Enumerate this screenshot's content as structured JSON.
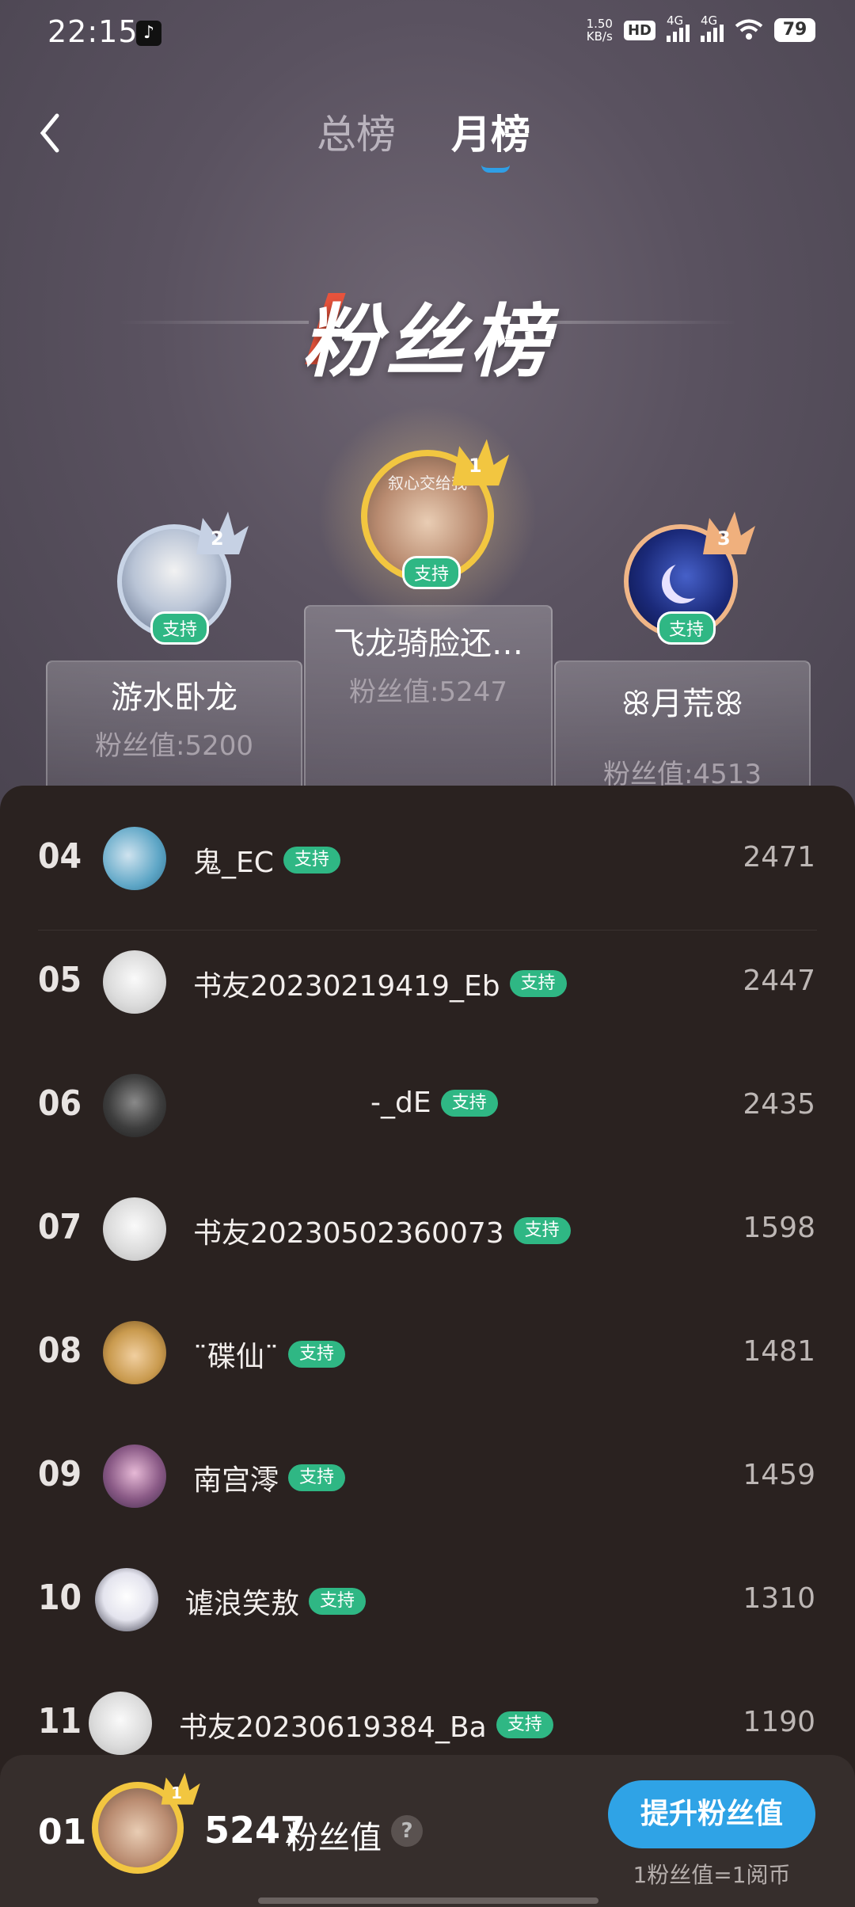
{
  "status_bar": {
    "time": "22:15",
    "net_speed_value": "1.50",
    "net_speed_unit": "KB/s",
    "hd_label": "HD",
    "sim1_label": "4G",
    "sim2_label": "4G",
    "battery": "79"
  },
  "nav": {
    "tabs": [
      {
        "label": "总榜",
        "active": false
      },
      {
        "label": "月榜",
        "active": true
      }
    ]
  },
  "title": "粉丝榜",
  "podium": {
    "first": {
      "name": "飞龙骑脸还…",
      "fans": "粉丝值:5247",
      "rank_badge": "1",
      "support_label": "支持",
      "avatar_text": "叙心交给我"
    },
    "second": {
      "name": "游水卧龙",
      "fans": "粉丝值:5200",
      "rank_badge": "2",
      "support_label": "支持"
    },
    "third": {
      "name": "月荒",
      "fans": "粉丝值:4513",
      "rank_badge": "3",
      "support_label": "支持"
    }
  },
  "list": [
    {
      "rank": "04",
      "name": "鬼_EC",
      "tag": "支持",
      "score": "2471"
    },
    {
      "rank": "05",
      "name": "书友20230219419_Eb",
      "tag": "支持",
      "score": "2447"
    },
    {
      "rank": "06",
      "name": "-_dE",
      "tag": "支持",
      "score": "2435"
    },
    {
      "rank": "07",
      "name": "书友20230502360073",
      "tag": "支持",
      "score": "1598"
    },
    {
      "rank": "08",
      "name": "¨碟仙¨",
      "tag": "支持",
      "score": "1481"
    },
    {
      "rank": "09",
      "name": "南宫澪",
      "tag": "支持",
      "score": "1459"
    },
    {
      "rank": "10",
      "name": "谑浪笑敖",
      "tag": "支持",
      "score": "1310"
    },
    {
      "rank": "11",
      "name": "书友20230619384_Ba",
      "tag": "支持",
      "score": "1190"
    }
  ],
  "me": {
    "rank": "01",
    "score": "5247",
    "unit": "粉丝值",
    "help": "?",
    "crown_number": "1",
    "boost_button": "提升粉丝值",
    "boost_note": "1粉丝值=1阅币"
  },
  "colors": {
    "accent_blue": "#2fa3e6",
    "support_green": "#2fb784",
    "gold": "#f2c640",
    "list_bg": "#2a2220"
  }
}
